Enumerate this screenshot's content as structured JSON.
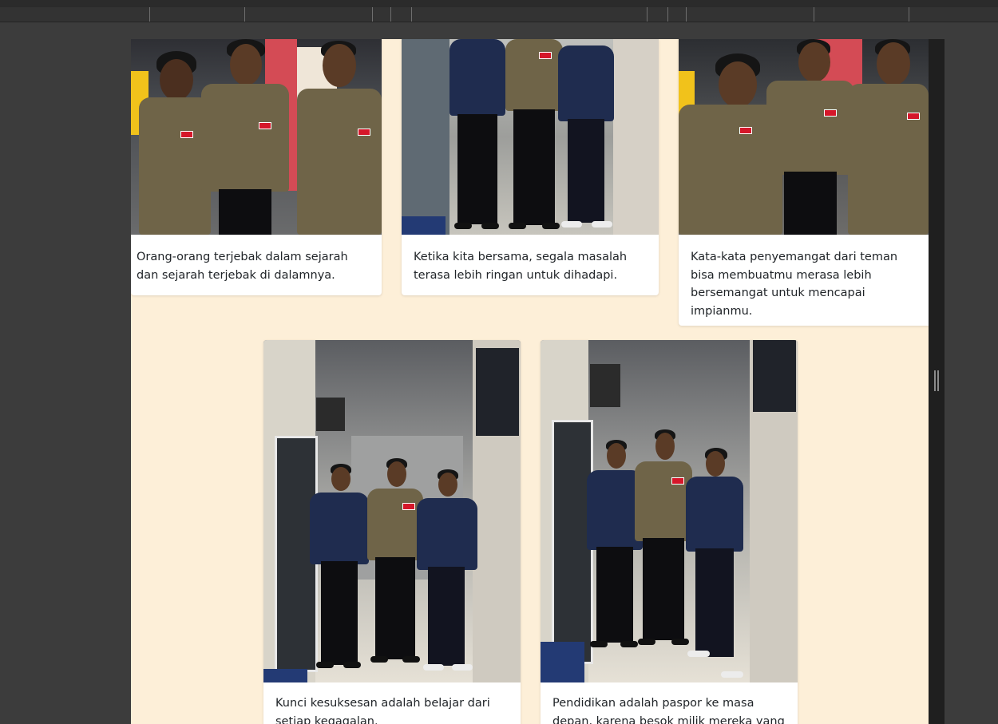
{
  "cards": [
    {
      "caption": "Orang-orang terjebak dalam sejarah dan sejarah terjebak di dalamnya.",
      "photo": "three-students-posing-photo"
    },
    {
      "caption": "Ketika kita bersama, segala masalah terasa lebih ringan untuk dihadapi.",
      "photo": "three-students-standing-photo"
    },
    {
      "caption": "Kata-kata penyemangat dari teman bisa membuatmu merasa lebih bersemangat untuk mencapai impianmu.",
      "photo": "three-students-smiling-photo"
    },
    {
      "caption": "Kunci kesuksesan adalah belajar dari setiap kegagalan.",
      "photo": "hallway-group-photo"
    },
    {
      "caption": "Pendidikan adalah paspor ke masa depan, karena besok milik mereka yang",
      "photo": "hallway-group-photo-2"
    }
  ],
  "colors": {
    "page_background": "#fdefd8",
    "viewer_background": "#3c3c3c",
    "card_background": "#ffffff",
    "caption_text": "#212529",
    "uniform_khaki": "#6f6448",
    "uniform_navy": "#1f2c4f",
    "badge_red": "#d5172a"
  }
}
